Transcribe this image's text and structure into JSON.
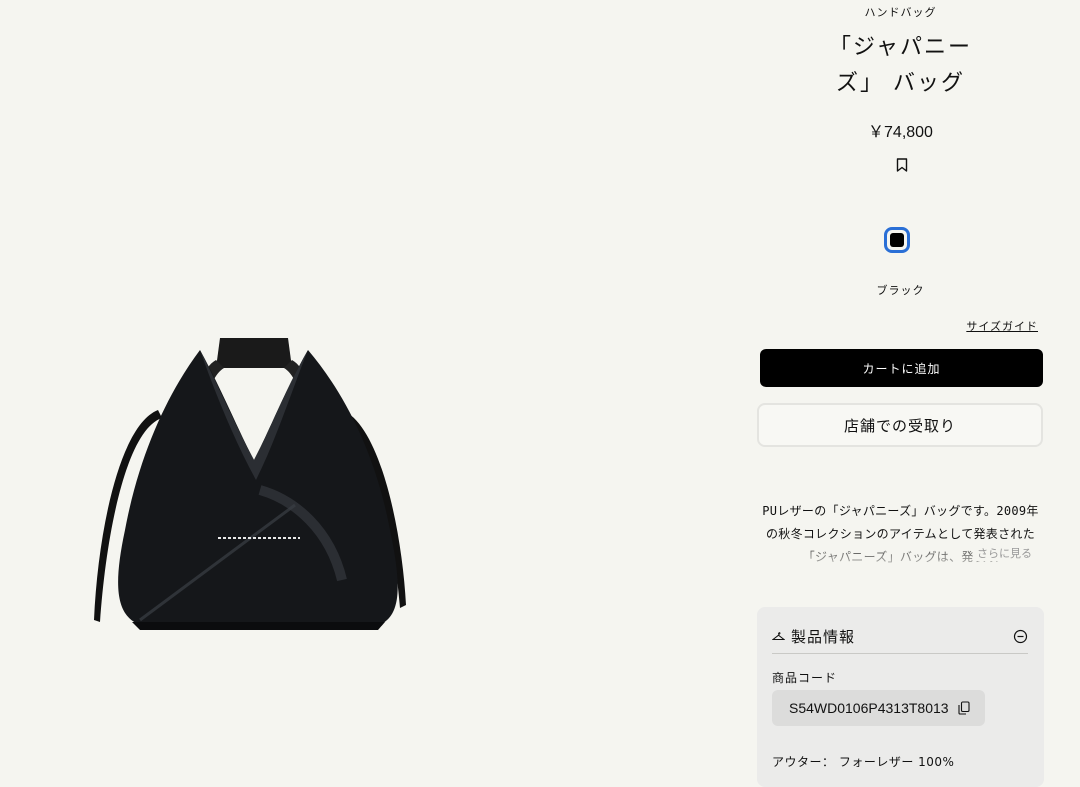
{
  "product": {
    "category": "ハンドバッグ",
    "title": "「ジャパニーズ」 バッグ",
    "price": "￥74,800",
    "color_name": "ブラック",
    "size_guide": "サイズガイド",
    "add_to_cart": "カートに追加",
    "store_pickup": "店舗での受取り",
    "description": "PUレザーの「ジャパニーズ」バッグです。2009年の秋冬コレクションのアイテムとして発表された「ジャパニーズ」バッグは、発表以",
    "read_more": "さらに見る"
  },
  "product_info": {
    "header": "製品情報",
    "code_label": "商品コード",
    "code": "S54WD0106P4313T8013",
    "material": "アウター： フォーレザー 100%"
  },
  "colors": {
    "selected_swatch": "#000000",
    "swatch_ring": "#2a6fd6",
    "cart_button": "#000000"
  },
  "icons": {
    "wishlist": "bookmark-icon",
    "hanger": "hanger-icon",
    "collapse": "minus-circle-icon",
    "copy": "copy-icon"
  }
}
